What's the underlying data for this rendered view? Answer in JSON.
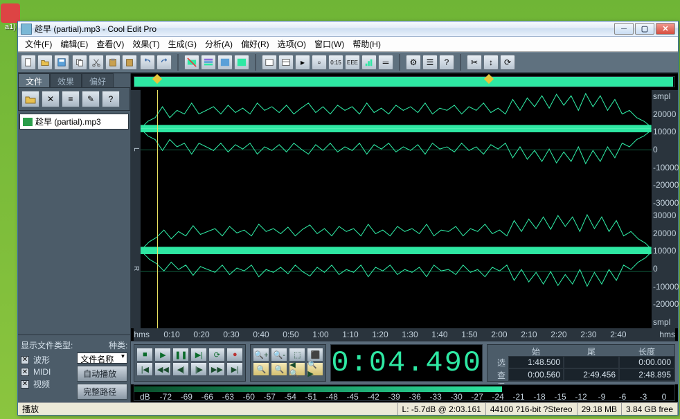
{
  "desktop": {
    "icon_label": "a1)"
  },
  "window": {
    "title": "趁早 (partial).mp3 - Cool Edit Pro"
  },
  "menu": {
    "file": "文件(F)",
    "edit": "编辑(E)",
    "view": "查看(V)",
    "effects": "效果(T)",
    "generate": "生成(G)",
    "analyze": "分析(A)",
    "favorites": "偏好(R)",
    "options": "选项(O)",
    "window": "窗口(W)",
    "help": "帮助(H)"
  },
  "sidebar": {
    "tabs": {
      "files": "文件",
      "effects": "效果",
      "favorites": "偏好"
    },
    "file_item": "趁早 (partial).mp3",
    "filter_header": "显示文件类型:",
    "filter_kind": "种类:",
    "chk_wave": "波形",
    "chk_midi": "MIDI",
    "chk_video": "视频",
    "select_label": "文件名称",
    "btn_autoplay": "自动播放",
    "btn_fullpath": "完整路径"
  },
  "ampscale": {
    "top": [
      "smpl",
      "20000",
      "10000",
      "0",
      "-10000",
      "-20000",
      "-30000"
    ],
    "bot": [
      "30000",
      "20000",
      "10000",
      "0",
      "-10000",
      "-20000",
      "smpl"
    ]
  },
  "timeruler": {
    "labels": [
      "hms",
      "0:10",
      "0:20",
      "0:30",
      "0:40",
      "0:50",
      "1:00",
      "1:10",
      "1:20",
      "1:30",
      "1:40",
      "1:50",
      "2:00",
      "2:10",
      "2:20",
      "2:30",
      "2:40",
      "hms"
    ]
  },
  "time_display": "0:04.490",
  "selinfo": {
    "hdr_begin": "始",
    "hdr_end": "尾",
    "hdr_length": "长度",
    "lbl_sel": "选",
    "lbl_view": "查看",
    "sel_begin": "1:48.500",
    "sel_end": "",
    "sel_len": "0:00.000",
    "view_begin": "0:00.560",
    "view_end": "2:49.456",
    "view_len": "2:48.895"
  },
  "levelscale": [
    "dB",
    "-72",
    "-69",
    "-66",
    "-63",
    "-60",
    "-57",
    "-54",
    "-51",
    "-48",
    "-45",
    "-42",
    "-39",
    "-36",
    "-33",
    "-30",
    "-27",
    "-24",
    "-21",
    "-18",
    "-15",
    "-12",
    "-9",
    "-6",
    "-3",
    "0"
  ],
  "status": {
    "left": "播放",
    "peak": "L: -5.7dB @  2:03.161",
    "format": "44100 ?16-bit ?Stereo",
    "size": "29.18 MB",
    "free": "3.84 GB free"
  }
}
